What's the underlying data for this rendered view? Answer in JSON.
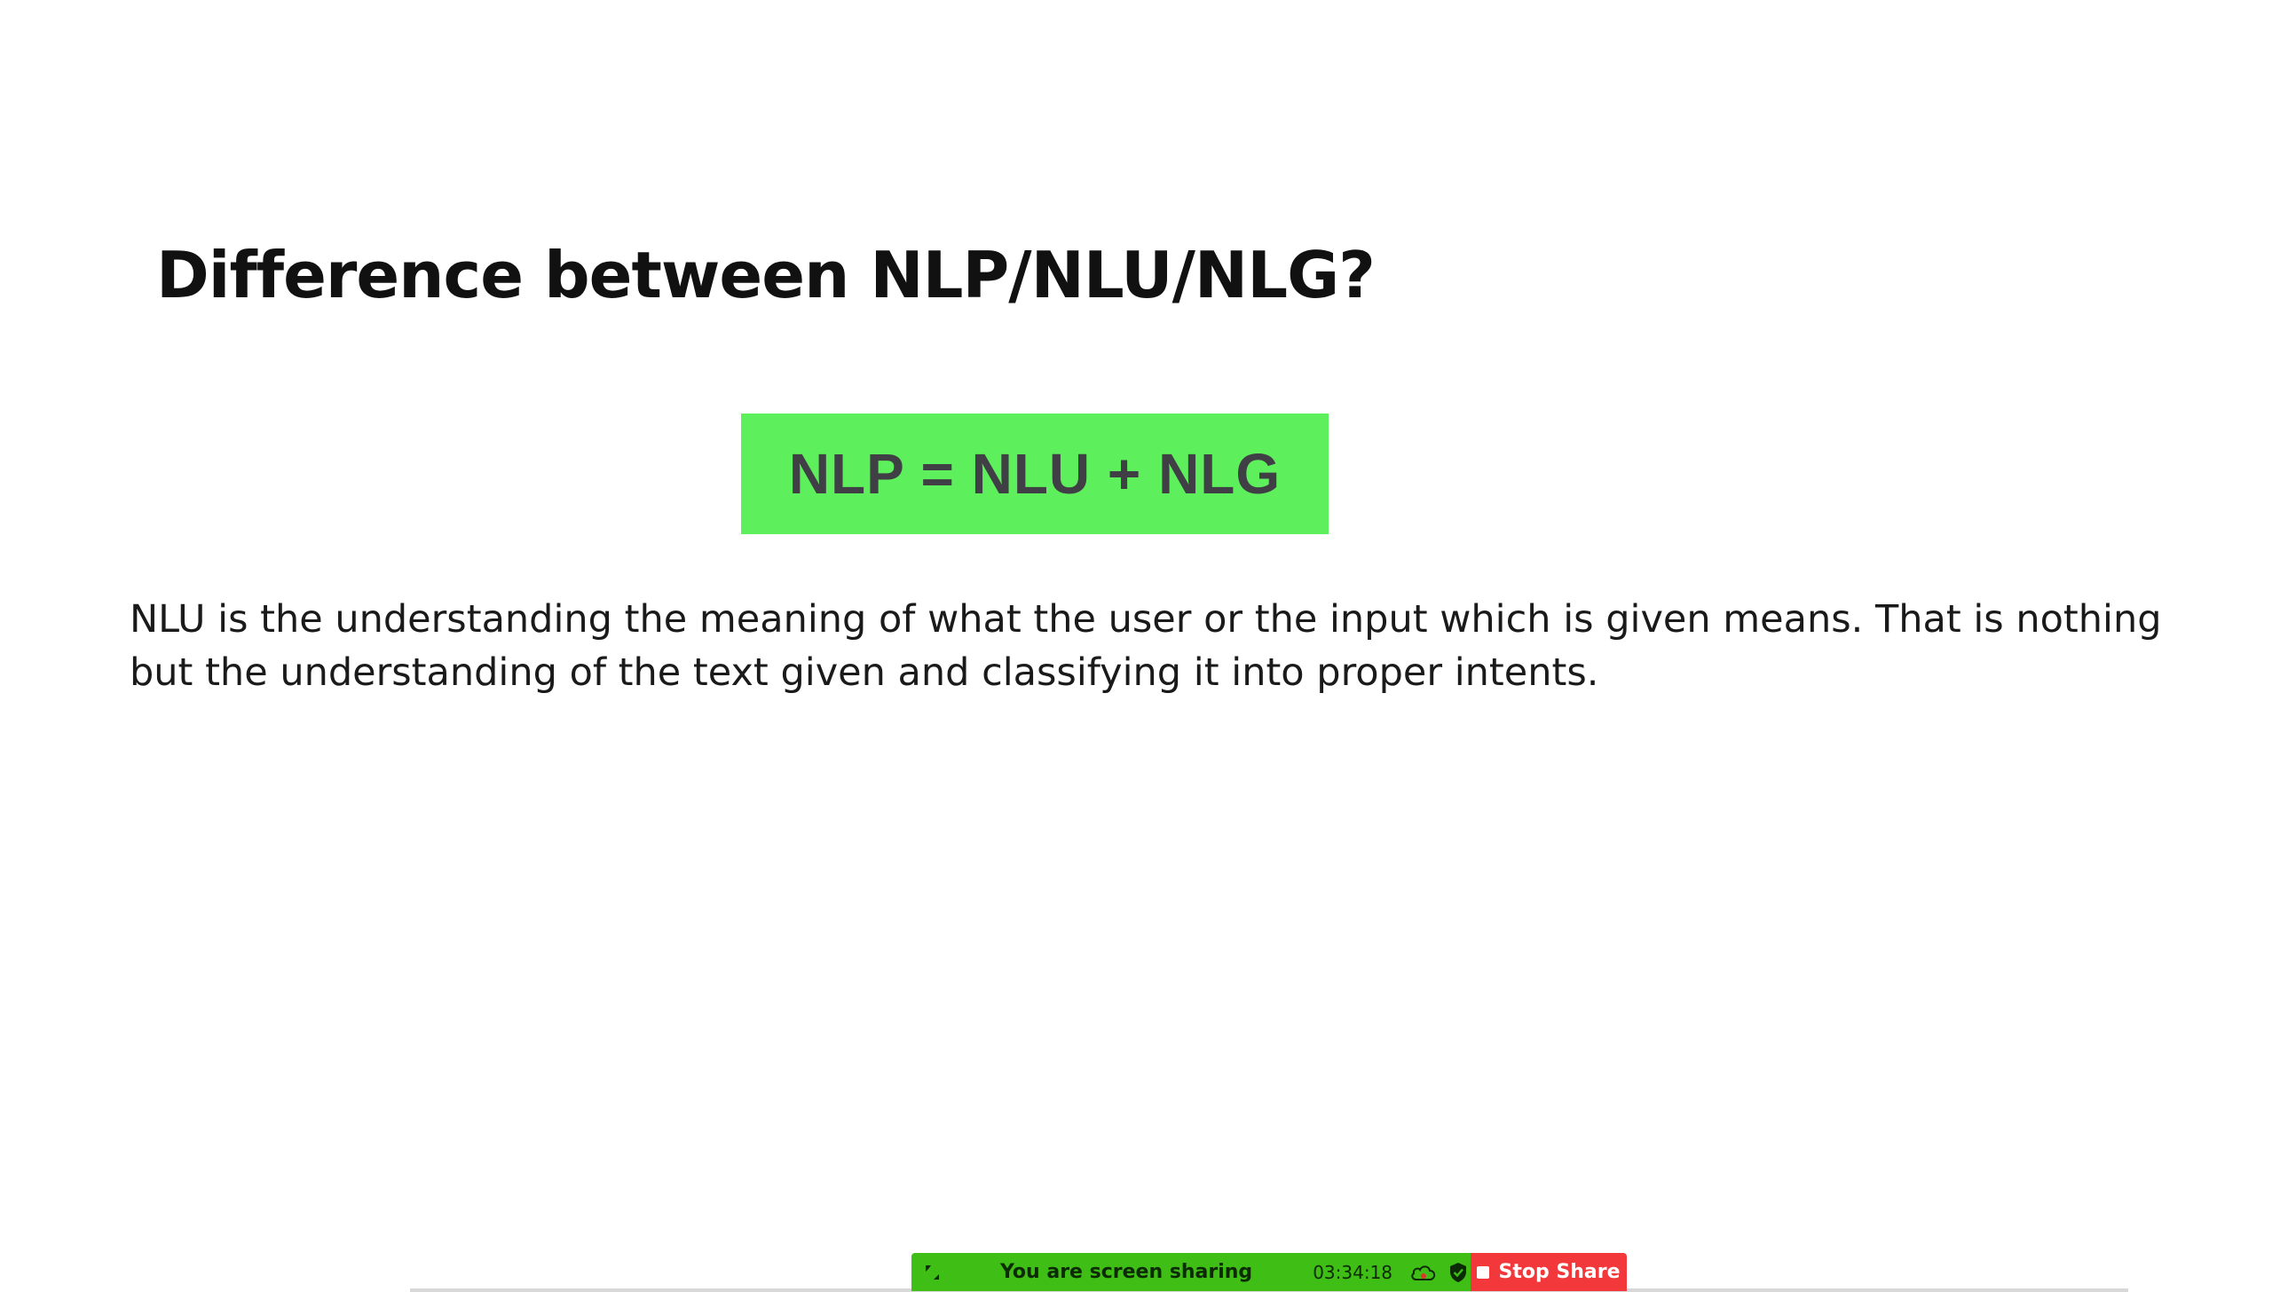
{
  "slide": {
    "title": "Difference between NLP/NLU/NLG?",
    "formula": "NLP = NLU + NLG",
    "body": "NLU is the understanding the meaning of what the user or the input which is given means. That is nothing but the understanding of the text given and classifying it into proper intents."
  },
  "share_toolbar": {
    "status_label": "You are screen sharing",
    "timer": "03:34:18",
    "stop_label": "Stop Share",
    "icons": [
      "grip-icon",
      "cloud-icon",
      "shield-icon",
      "stop-icon"
    ],
    "colors": {
      "bar": "#3fbe16",
      "stop": "#f2383b",
      "formula_box": "#5eef5c"
    }
  }
}
